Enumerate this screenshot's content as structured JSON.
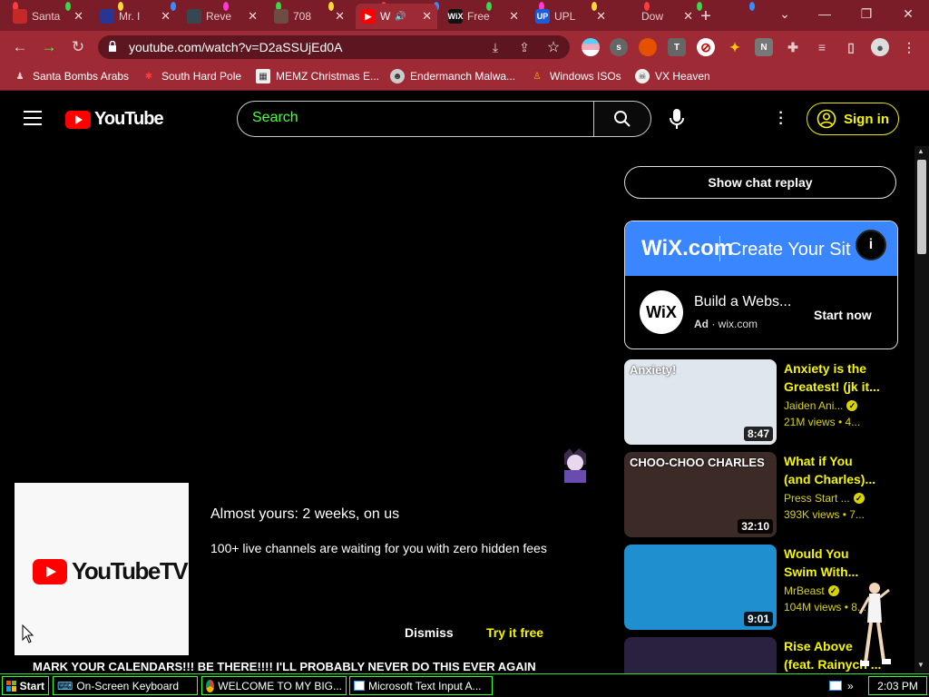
{
  "browser": {
    "tabs": [
      {
        "title": "Santa",
        "fav_color": "#c62828",
        "fav_text": "",
        "active": false
      },
      {
        "title": "Mr. I",
        "fav_color": "#283593",
        "fav_text": "",
        "active": false
      },
      {
        "title": "Reve",
        "fav_color": "#37474f",
        "fav_text": "",
        "active": false
      },
      {
        "title": "708",
        "fav_color": "#6d4c41",
        "fav_text": "",
        "active": false
      },
      {
        "title": "W",
        "fav_color": "#ff0000",
        "fav_text": "▶",
        "active": true
      },
      {
        "title": "Free",
        "fav_color": "#111111",
        "fav_text": "WiX",
        "active": false
      },
      {
        "title": "UPL",
        "fav_color": "#1e5bd8",
        "fav_text": "UP",
        "active": false
      },
      {
        "title": "Dow",
        "fav_color": "#7a1d28",
        "fav_text": "",
        "active": false
      }
    ],
    "new_tab_label": "+",
    "url": "youtube.com/watch?v=D2aSSUjEd0A",
    "extension_letters": [
      "s",
      "T",
      "N"
    ],
    "bookmarks": [
      "Santa Bombs Arabs",
      "South Hard Pole",
      "MEMZ Christmas E...",
      "Endermanch Malwa...",
      "Windows ISOs",
      "VX Heaven"
    ]
  },
  "youtube": {
    "logo_text": "YouTube",
    "search_placeholder": "Search",
    "sign_in_label": "Sign in",
    "show_chat_replay": "Show chat replay",
    "ad": {
      "banner_brand": "WiX.com",
      "banner_headline": "Create Your Sit",
      "avatar_text": "WiX",
      "title": "Build a Webs...",
      "badge": "Ad",
      "source": "wix.com",
      "cta": "Start now",
      "info_icon": "i"
    },
    "recommendations": [
      {
        "title_line1": "Anxiety is the",
        "title_line2": "Greatest! (jk it...",
        "channel": "Jaiden Ani...",
        "verified": true,
        "meta": "21M views  • 4...",
        "duration": "8:47",
        "thumb_color": "#dfe6ee",
        "thumb_text": "Anxiety!"
      },
      {
        "title_line1": "What if You",
        "title_line2": "(and Charles)...",
        "channel": "Press Start ...",
        "verified": true,
        "meta": "393K views  • 7...",
        "duration": "32:10",
        "thumb_color": "#3b2a26",
        "thumb_text": "CHOO-CHOO CHARLES"
      },
      {
        "title_line1": "Would You",
        "title_line2": "Swim With...",
        "channel": "MrBeast",
        "verified": true,
        "meta": "104M views  • 8...",
        "duration": "9:01",
        "thumb_color": "#1f8fd0",
        "thumb_text": ""
      },
      {
        "title_line1": "Rise Above",
        "title_line2": "(feat. Rainych ...",
        "channel": "",
        "verified": false,
        "meta": "",
        "duration": "",
        "thumb_color": "#2a2140",
        "thumb_text": ""
      }
    ],
    "promo": {
      "logo_text": "YouTubeTV",
      "title": "Almost yours: 2 weeks, on us",
      "description": "100+ live channels are waiting for you with zero hidden fees",
      "dismiss": "Dismiss",
      "try_free": "Try it free"
    },
    "video_title": "MARK YOUR CALENDARS!!! BE THERE!!!! I'LL PROBABLY NEVER DO THIS EVER AGAIN"
  },
  "taskbar": {
    "start": "Start",
    "items": [
      "On-Screen Keyboard",
      "WELCOME TO MY BIG...",
      "Microsoft Text Input A..."
    ],
    "tray_expand": "»",
    "clock": "2:03 PM"
  },
  "colors": {
    "accent_yellow": "#f5f500",
    "search_green": "#4bff3f",
    "chrome_red": "#9e2a36",
    "taskbar_green": "#33ff33"
  }
}
